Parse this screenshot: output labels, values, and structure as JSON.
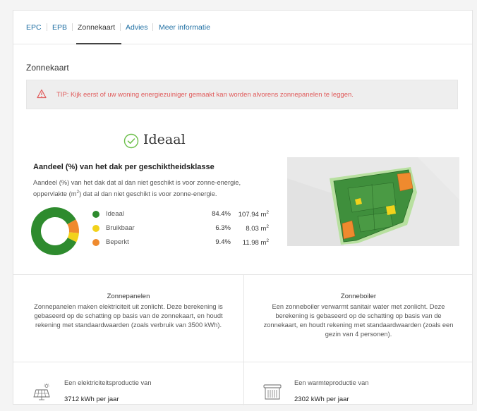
{
  "tabs": [
    {
      "label": "EPC"
    },
    {
      "label": "EPB"
    },
    {
      "label": "Zonnekaart"
    },
    {
      "label": "Advies"
    },
    {
      "label": "Meer informatie"
    }
  ],
  "active_tab": "Zonnekaart",
  "section": {
    "title": "Zonnekaart"
  },
  "tip": {
    "text": "TIP: Kijk eerst of uw woning energiezuiniger gemaakt kan worden alvorens zonnepanelen te leggen."
  },
  "rating": {
    "label": "Ideaal"
  },
  "share": {
    "title": "Aandeel (%) van het dak per geschiktheidsklasse",
    "desc_line1": "Aandeel (%) van het dak dat al dan niet geschikt is voor zonne-energie,",
    "desc_line2a": "oppervlakte (m",
    "desc_line2sup": "2",
    "desc_line2b": ") dat al dan niet geschikt is voor zonne-energie.",
    "classes": [
      {
        "name": "Ideaal",
        "pct": "84.4%",
        "area": "107.94 m",
        "sup": "2",
        "color": "#2e8b2e"
      },
      {
        "name": "Bruikbaar",
        "pct": "6.3%",
        "area": "8.03 m",
        "sup": "2",
        "color": "#f2d21b"
      },
      {
        "name": "Beperkt",
        "pct": "9.4%",
        "area": "11.98 m",
        "sup": "2",
        "color": "#ef8a2e"
      }
    ]
  },
  "chart_data": {
    "type": "pie",
    "categories": [
      "Ideaal",
      "Bruikbaar",
      "Beperkt"
    ],
    "values": [
      84.4,
      6.3,
      9.4
    ],
    "colors": [
      "#2e8b2e",
      "#f2d21b",
      "#ef8a2e"
    ]
  },
  "panels": {
    "title": "Zonnepanelen",
    "text": "Zonnepanelen maken elektriciteit uit zonlicht. Deze berekening is gebaseerd op de schatting op basis van de zonnekaart, en houdt rekening met standaardwaarden (zoals verbruik van 3500 kWh).",
    "prod_label": "Een elektriciteitsproductie van",
    "prod_value": "3712 kWh per jaar"
  },
  "boiler": {
    "title": "Zonneboiler",
    "text": "Een zonneboiler verwarmt sanitair water met zonlicht. Deze berekening is gebaseerd op de schatting op basis van de zonnekaart, en houdt rekening met standaardwaarden (zoals een gezin van 4 personen).",
    "prod_label": "Een warmteproductie van",
    "prod_value": "2302 kWh per jaar"
  },
  "colors": {
    "accent": "#1f6fa3",
    "warning": "#e05a5a",
    "ideal_green": "#6cbf4a"
  }
}
